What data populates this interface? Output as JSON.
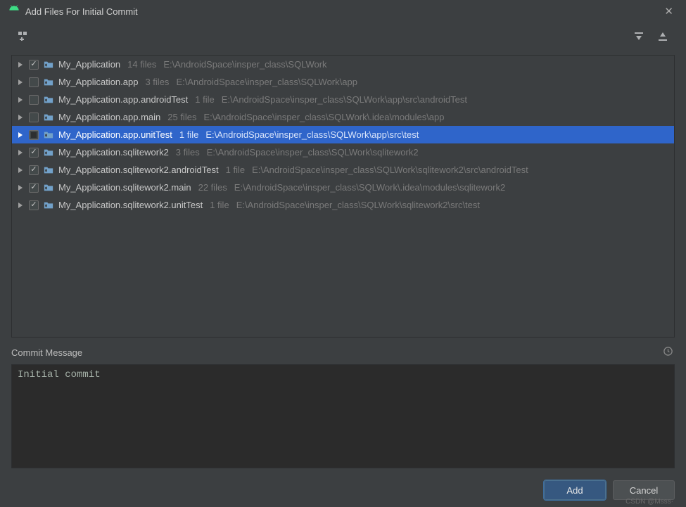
{
  "window": {
    "title": "Add Files For Initial Commit"
  },
  "commit": {
    "label": "Commit Message",
    "message": "Initial commit"
  },
  "buttons": {
    "add": "Add",
    "cancel": "Cancel"
  },
  "watermark": "CSDN @Msss·",
  "tree": [
    {
      "name": "My_Application",
      "files": "14 files",
      "path": "E:\\AndroidSpace\\insper_class\\SQLWork",
      "checked": "checked",
      "selected": false
    },
    {
      "name": "My_Application.app",
      "files": "3 files",
      "path": "E:\\AndroidSpace\\insper_class\\SQLWork\\app",
      "checked": "unchecked",
      "selected": false
    },
    {
      "name": "My_Application.app.androidTest",
      "files": "1 file",
      "path": "E:\\AndroidSpace\\insper_class\\SQLWork\\app\\src\\androidTest",
      "checked": "unchecked",
      "selected": false
    },
    {
      "name": "My_Application.app.main",
      "files": "25 files",
      "path": "E:\\AndroidSpace\\insper_class\\SQLWork\\.idea\\modules\\app",
      "checked": "unchecked",
      "selected": false
    },
    {
      "name": "My_Application.app.unitTest",
      "files": "1 file",
      "path": "E:\\AndroidSpace\\insper_class\\SQLWork\\app\\src\\test",
      "checked": "indet",
      "selected": true
    },
    {
      "name": "My_Application.sqlitework2",
      "files": "3 files",
      "path": "E:\\AndroidSpace\\insper_class\\SQLWork\\sqlitework2",
      "checked": "checked",
      "selected": false
    },
    {
      "name": "My_Application.sqlitework2.androidTest",
      "files": "1 file",
      "path": "E:\\AndroidSpace\\insper_class\\SQLWork\\sqlitework2\\src\\androidTest",
      "checked": "checked",
      "selected": false
    },
    {
      "name": "My_Application.sqlitework2.main",
      "files": "22 files",
      "path": "E:\\AndroidSpace\\insper_class\\SQLWork\\.idea\\modules\\sqlitework2",
      "checked": "checked",
      "selected": false
    },
    {
      "name": "My_Application.sqlitework2.unitTest",
      "files": "1 file",
      "path": "E:\\AndroidSpace\\insper_class\\SQLWork\\sqlitework2\\src\\test",
      "checked": "checked",
      "selected": false
    }
  ]
}
